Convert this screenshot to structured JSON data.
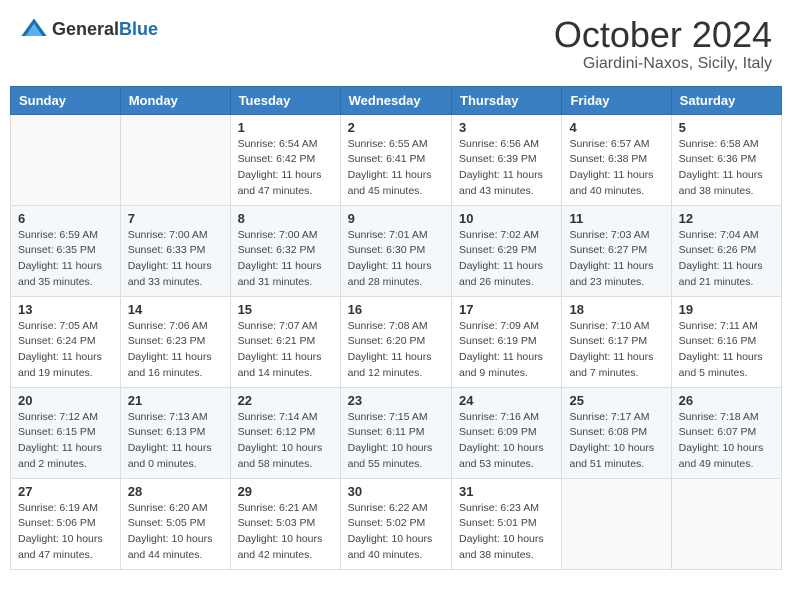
{
  "header": {
    "logo_general": "General",
    "logo_blue": "Blue",
    "month": "October 2024",
    "location": "Giardini-Naxos, Sicily, Italy"
  },
  "weekdays": [
    "Sunday",
    "Monday",
    "Tuesday",
    "Wednesday",
    "Thursday",
    "Friday",
    "Saturday"
  ],
  "weeks": [
    [
      {
        "day": "",
        "sunrise": "",
        "sunset": "",
        "daylight": ""
      },
      {
        "day": "",
        "sunrise": "",
        "sunset": "",
        "daylight": ""
      },
      {
        "day": "1",
        "sunrise": "Sunrise: 6:54 AM",
        "sunset": "Sunset: 6:42 PM",
        "daylight": "Daylight: 11 hours and 47 minutes."
      },
      {
        "day": "2",
        "sunrise": "Sunrise: 6:55 AM",
        "sunset": "Sunset: 6:41 PM",
        "daylight": "Daylight: 11 hours and 45 minutes."
      },
      {
        "day": "3",
        "sunrise": "Sunrise: 6:56 AM",
        "sunset": "Sunset: 6:39 PM",
        "daylight": "Daylight: 11 hours and 43 minutes."
      },
      {
        "day": "4",
        "sunrise": "Sunrise: 6:57 AM",
        "sunset": "Sunset: 6:38 PM",
        "daylight": "Daylight: 11 hours and 40 minutes."
      },
      {
        "day": "5",
        "sunrise": "Sunrise: 6:58 AM",
        "sunset": "Sunset: 6:36 PM",
        "daylight": "Daylight: 11 hours and 38 minutes."
      }
    ],
    [
      {
        "day": "6",
        "sunrise": "Sunrise: 6:59 AM",
        "sunset": "Sunset: 6:35 PM",
        "daylight": "Daylight: 11 hours and 35 minutes."
      },
      {
        "day": "7",
        "sunrise": "Sunrise: 7:00 AM",
        "sunset": "Sunset: 6:33 PM",
        "daylight": "Daylight: 11 hours and 33 minutes."
      },
      {
        "day": "8",
        "sunrise": "Sunrise: 7:00 AM",
        "sunset": "Sunset: 6:32 PM",
        "daylight": "Daylight: 11 hours and 31 minutes."
      },
      {
        "day": "9",
        "sunrise": "Sunrise: 7:01 AM",
        "sunset": "Sunset: 6:30 PM",
        "daylight": "Daylight: 11 hours and 28 minutes."
      },
      {
        "day": "10",
        "sunrise": "Sunrise: 7:02 AM",
        "sunset": "Sunset: 6:29 PM",
        "daylight": "Daylight: 11 hours and 26 minutes."
      },
      {
        "day": "11",
        "sunrise": "Sunrise: 7:03 AM",
        "sunset": "Sunset: 6:27 PM",
        "daylight": "Daylight: 11 hours and 23 minutes."
      },
      {
        "day": "12",
        "sunrise": "Sunrise: 7:04 AM",
        "sunset": "Sunset: 6:26 PM",
        "daylight": "Daylight: 11 hours and 21 minutes."
      }
    ],
    [
      {
        "day": "13",
        "sunrise": "Sunrise: 7:05 AM",
        "sunset": "Sunset: 6:24 PM",
        "daylight": "Daylight: 11 hours and 19 minutes."
      },
      {
        "day": "14",
        "sunrise": "Sunrise: 7:06 AM",
        "sunset": "Sunset: 6:23 PM",
        "daylight": "Daylight: 11 hours and 16 minutes."
      },
      {
        "day": "15",
        "sunrise": "Sunrise: 7:07 AM",
        "sunset": "Sunset: 6:21 PM",
        "daylight": "Daylight: 11 hours and 14 minutes."
      },
      {
        "day": "16",
        "sunrise": "Sunrise: 7:08 AM",
        "sunset": "Sunset: 6:20 PM",
        "daylight": "Daylight: 11 hours and 12 minutes."
      },
      {
        "day": "17",
        "sunrise": "Sunrise: 7:09 AM",
        "sunset": "Sunset: 6:19 PM",
        "daylight": "Daylight: 11 hours and 9 minutes."
      },
      {
        "day": "18",
        "sunrise": "Sunrise: 7:10 AM",
        "sunset": "Sunset: 6:17 PM",
        "daylight": "Daylight: 11 hours and 7 minutes."
      },
      {
        "day": "19",
        "sunrise": "Sunrise: 7:11 AM",
        "sunset": "Sunset: 6:16 PM",
        "daylight": "Daylight: 11 hours and 5 minutes."
      }
    ],
    [
      {
        "day": "20",
        "sunrise": "Sunrise: 7:12 AM",
        "sunset": "Sunset: 6:15 PM",
        "daylight": "Daylight: 11 hours and 2 minutes."
      },
      {
        "day": "21",
        "sunrise": "Sunrise: 7:13 AM",
        "sunset": "Sunset: 6:13 PM",
        "daylight": "Daylight: 11 hours and 0 minutes."
      },
      {
        "day": "22",
        "sunrise": "Sunrise: 7:14 AM",
        "sunset": "Sunset: 6:12 PM",
        "daylight": "Daylight: 10 hours and 58 minutes."
      },
      {
        "day": "23",
        "sunrise": "Sunrise: 7:15 AM",
        "sunset": "Sunset: 6:11 PM",
        "daylight": "Daylight: 10 hours and 55 minutes."
      },
      {
        "day": "24",
        "sunrise": "Sunrise: 7:16 AM",
        "sunset": "Sunset: 6:09 PM",
        "daylight": "Daylight: 10 hours and 53 minutes."
      },
      {
        "day": "25",
        "sunrise": "Sunrise: 7:17 AM",
        "sunset": "Sunset: 6:08 PM",
        "daylight": "Daylight: 10 hours and 51 minutes."
      },
      {
        "day": "26",
        "sunrise": "Sunrise: 7:18 AM",
        "sunset": "Sunset: 6:07 PM",
        "daylight": "Daylight: 10 hours and 49 minutes."
      }
    ],
    [
      {
        "day": "27",
        "sunrise": "Sunrise: 6:19 AM",
        "sunset": "Sunset: 5:06 PM",
        "daylight": "Daylight: 10 hours and 47 minutes."
      },
      {
        "day": "28",
        "sunrise": "Sunrise: 6:20 AM",
        "sunset": "Sunset: 5:05 PM",
        "daylight": "Daylight: 10 hours and 44 minutes."
      },
      {
        "day": "29",
        "sunrise": "Sunrise: 6:21 AM",
        "sunset": "Sunset: 5:03 PM",
        "daylight": "Daylight: 10 hours and 42 minutes."
      },
      {
        "day": "30",
        "sunrise": "Sunrise: 6:22 AM",
        "sunset": "Sunset: 5:02 PM",
        "daylight": "Daylight: 10 hours and 40 minutes."
      },
      {
        "day": "31",
        "sunrise": "Sunrise: 6:23 AM",
        "sunset": "Sunset: 5:01 PM",
        "daylight": "Daylight: 10 hours and 38 minutes."
      },
      {
        "day": "",
        "sunrise": "",
        "sunset": "",
        "daylight": ""
      },
      {
        "day": "",
        "sunrise": "",
        "sunset": "",
        "daylight": ""
      }
    ]
  ]
}
